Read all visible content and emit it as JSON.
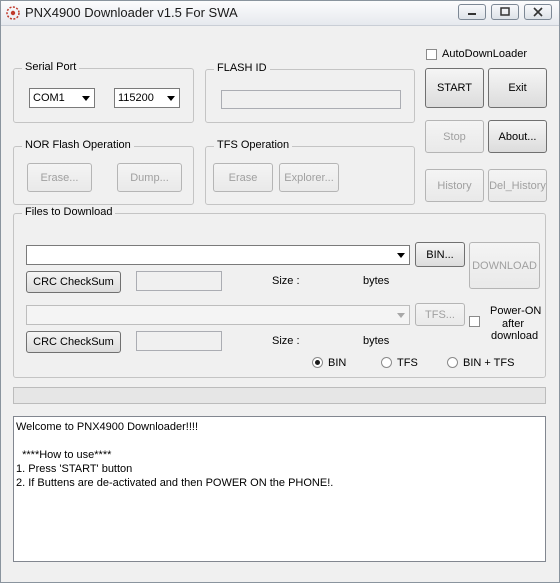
{
  "window": {
    "title": "PNX4900 Downloader v1.5 For SWA"
  },
  "serial_port": {
    "legend": "Serial Port",
    "port": "COM1",
    "baud": "115200"
  },
  "flash_id": {
    "legend": "FLASH ID",
    "value": ""
  },
  "nor_flash": {
    "legend": "NOR Flash Operation",
    "erase_label": "Erase...",
    "dump_label": "Dump..."
  },
  "tfs_op": {
    "legend": "TFS Operation",
    "erase_label": "Erase",
    "explorer_label": "Explorer..."
  },
  "side": {
    "auto_download_label": "AutoDownLoader",
    "start_label": "START",
    "exit_label": "Exit",
    "stop_label": "Stop",
    "about_label": "About...",
    "history_label": "History",
    "del_history_label": "Del_History"
  },
  "files": {
    "legend": "Files to Download",
    "bin_path": "",
    "bin_button": "BIN...",
    "download_label": "DOWNLOAD",
    "crc_label_1": "CRC CheckSum",
    "crc_value_1": "",
    "size_label_1": "Size :",
    "bytes_label_1": "bytes",
    "tfs_path": "",
    "tfs_button": "TFS...",
    "power_on_line1": "Power-ON",
    "power_on_line2": "after",
    "power_on_line3": "download",
    "crc_label_2": "CRC CheckSum",
    "crc_value_2": "",
    "size_label_2": "Size :",
    "bytes_label_2": "bytes",
    "radio_bin": "BIN",
    "radio_tfs": "TFS",
    "radio_bin_tfs": "BIN + TFS",
    "selected_mode": "BIN"
  },
  "progress": {
    "fraction": 0
  },
  "log": {
    "lines": [
      "Welcome to PNX4900 Downloader!!!!",
      "",
      "  ****How to use****",
      "1. Press 'START' button",
      "2. If Buttens are de-activated and then POWER ON the PHONE!."
    ]
  },
  "colors": {
    "window_bg": "#f0f0f0",
    "disabled_text": "#a0a0a0"
  }
}
